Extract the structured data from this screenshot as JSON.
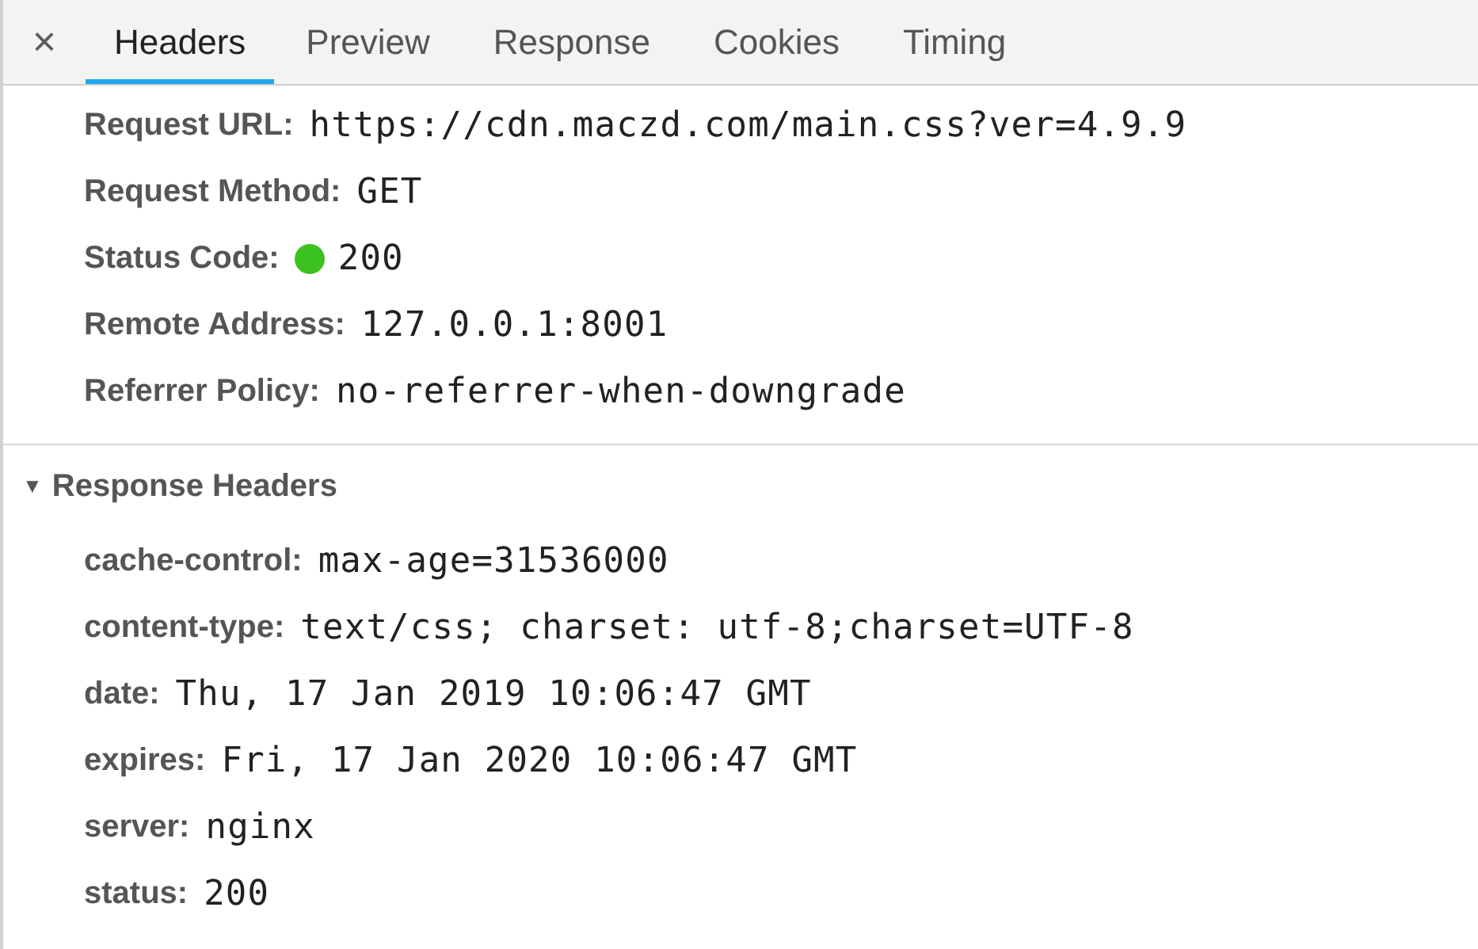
{
  "close_button": "×",
  "tabs": [
    {
      "label": "Headers",
      "selected": true
    },
    {
      "label": "Preview",
      "selected": false
    },
    {
      "label": "Response",
      "selected": false
    },
    {
      "label": "Cookies",
      "selected": false
    },
    {
      "label": "Timing",
      "selected": false
    }
  ],
  "general": [
    {
      "name": "Request URL:",
      "value": "https://cdn.maczd.com/main.css?ver=4.9.9"
    },
    {
      "name": "Request Method:",
      "value": "GET"
    },
    {
      "name": "Status Code:",
      "value": "200",
      "color": "#3cc21f"
    },
    {
      "name": "Remote Address:",
      "value": "127.0.0.1:8001"
    },
    {
      "name": "Referrer Policy:",
      "value": "no-referrer-when-downgrade"
    }
  ],
  "response_headers": {
    "title": "Response Headers",
    "expanded": true,
    "toggle": "▼",
    "items": [
      {
        "name": "cache-control:",
        "value": "max-age=31536000"
      },
      {
        "name": "content-type:",
        "value": "text/css; charset: utf-8;charset=UTF-8"
      },
      {
        "name": "date:",
        "value": "Thu, 17 Jan 2019 10:06:47 GMT"
      },
      {
        "name": "expires:",
        "value": "Fri, 17 Jan 2020 10:06:47 GMT"
      },
      {
        "name": "server:",
        "value": "nginx"
      },
      {
        "name": "status:",
        "value": "200"
      }
    ]
  }
}
